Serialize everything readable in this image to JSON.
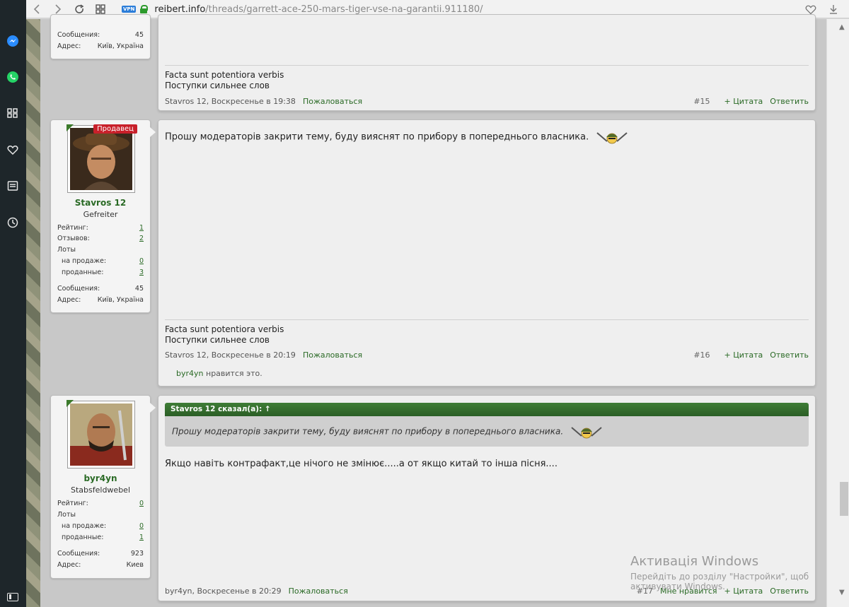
{
  "browser": {
    "url_host": "reibert.info",
    "url_path": "/threads/garrett-ace-250-mars-tiger-vse-na-garantii.911180/",
    "vpn_label": "VPN"
  },
  "posts": [
    {
      "id": "post15",
      "user": {
        "stats": [
          {
            "label": "Сообщения:",
            "value": "45"
          },
          {
            "label": "Адрес:",
            "value": "Київ, Україна"
          }
        ]
      },
      "signature_lines": [
        "Facta sunt potentiora verbis",
        "Поступки сильнее слов"
      ],
      "footer": {
        "author_date": "Stavros 12, Воскресенье в 19:38",
        "report": "Пожаловаться",
        "number": "#15",
        "quote": "+ Цитата",
        "reply": "Ответить"
      }
    },
    {
      "id": "post16",
      "user": {
        "name": "Stavros 12",
        "title": "Gefreiter",
        "badge": "Продавец",
        "stats": [
          {
            "label": "Рейтинг:",
            "value": "1"
          },
          {
            "label": "Отзывов:",
            "value": "2"
          },
          {
            "label": "Лоты",
            "value": ""
          },
          {
            "label": "на продаже:",
            "value": "0"
          },
          {
            "label": "проданные:",
            "value": "3"
          },
          {
            "label": "Сообщения:",
            "value": "45"
          },
          {
            "label": "Адрес:",
            "value": "Київ, Україна"
          }
        ]
      },
      "text": "Прошу модераторів закрити тему, буду вияснят по прибору в попереднього власника.",
      "signature_lines": [
        "Facta sunt potentiora verbis",
        "Поступки сильнее слов"
      ],
      "footer": {
        "author_date": "Stavros 12, Воскресенье в 20:19",
        "report": "Пожаловаться",
        "number": "#16",
        "quote": "+ Цитата",
        "reply": "Ответить"
      },
      "likes": {
        "user": "byr4yn",
        "text": " нравится это."
      }
    },
    {
      "id": "post17",
      "user": {
        "name": "byr4yn",
        "title": "Stabsfeldwebel",
        "stats": [
          {
            "label": "Рейтинг:",
            "value": "0"
          },
          {
            "label": "Лоты",
            "value": ""
          },
          {
            "label": "на продаже:",
            "value": "0"
          },
          {
            "label": "проданные:",
            "value": "1"
          },
          {
            "label": "Сообщения:",
            "value": "923"
          },
          {
            "label": "Адрес:",
            "value": "Киев"
          }
        ]
      },
      "quote": {
        "header": "Stavros 12 сказал(а): ↑",
        "text": "Прошу модераторів закрити тему, буду вияснят по прибору в попереднього власника."
      },
      "text": "Якщо навіть контрафакт,це нічого не змінює.....а от якщо китай то інша пісня....",
      "footer": {
        "author_date": "byr4yn, Воскресенье в 20:29",
        "report": "Пожаловаться",
        "number": "#17",
        "like": "Мне нравится",
        "quote": "+ Цитата",
        "reply": "Ответить"
      }
    }
  ],
  "watermark": {
    "title": "Активація Windows",
    "subtitle": "Перейдіть до розділу \"Настройки\", щоб активувати Windows."
  }
}
